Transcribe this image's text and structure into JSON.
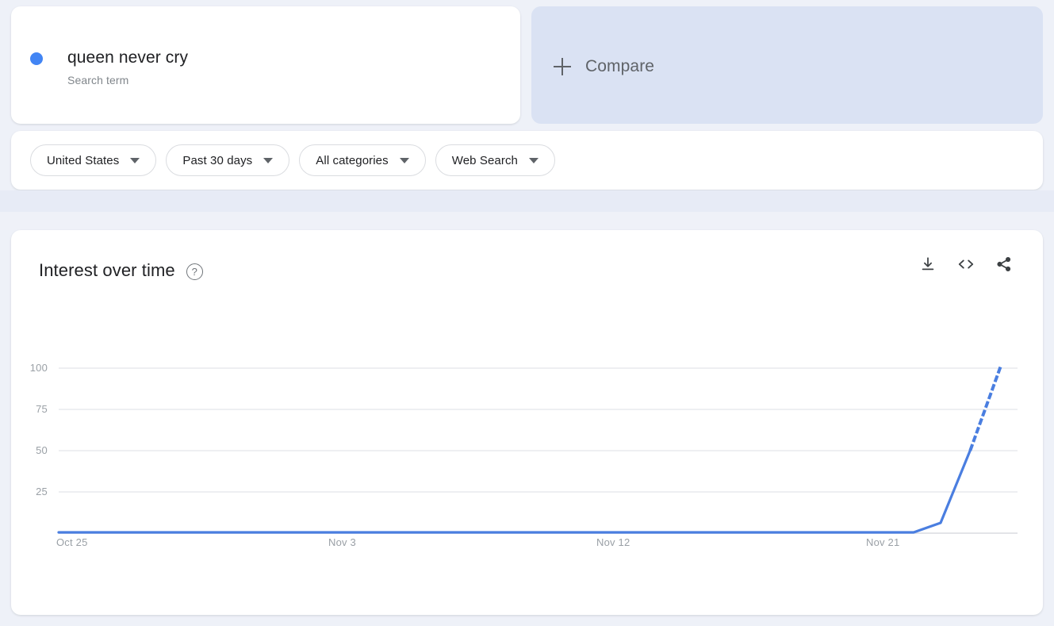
{
  "term_card": {
    "title": "queen never cry",
    "subtitle": "Search term",
    "dot_color": "#4285f4"
  },
  "compare_card": {
    "label": "Compare",
    "plus_icon": "plus-icon",
    "background": "#dae2f3"
  },
  "filters": [
    {
      "label": "United States"
    },
    {
      "label": "Past 30 days"
    },
    {
      "label": "All categories"
    },
    {
      "label": "Web Search"
    }
  ],
  "chart_card": {
    "title": "Interest over time",
    "help_icon": "help-circle-icon",
    "help_glyph": "?",
    "actions": [
      {
        "name": "download-icon"
      },
      {
        "name": "embed-code-icon"
      },
      {
        "name": "share-icon"
      }
    ]
  },
  "chart_data": {
    "type": "line",
    "title": "Interest over time",
    "xlabel": "",
    "ylabel": "",
    "ylim": [
      0,
      100
    ],
    "y_ticks": [
      100,
      75,
      50,
      25
    ],
    "x_ticks": [
      "Oct 25",
      "Nov 3",
      "Nov 12",
      "Nov 21"
    ],
    "grid": true,
    "legend": "none",
    "line_color": "#4a7ee0",
    "series": [
      {
        "name": "queen never cry",
        "partial_from_index": 29,
        "x": [
          "Oct 25",
          "Oct 26",
          "Oct 27",
          "Oct 28",
          "Oct 29",
          "Oct 30",
          "Oct 31",
          "Nov 1",
          "Nov 2",
          "Nov 3",
          "Nov 4",
          "Nov 5",
          "Nov 6",
          "Nov 7",
          "Nov 8",
          "Nov 9",
          "Nov 10",
          "Nov 11",
          "Nov 12",
          "Nov 13",
          "Nov 14",
          "Nov 15",
          "Nov 16",
          "Nov 17",
          "Nov 18",
          "Nov 19",
          "Nov 20",
          "Nov 21",
          "Nov 22",
          "Nov 23",
          "Nov 24"
        ],
        "values": [
          0,
          0,
          0,
          0,
          0,
          0,
          0,
          0,
          0,
          0,
          0,
          0,
          0,
          0,
          0,
          0,
          0,
          0,
          0,
          0,
          0,
          0,
          0,
          0,
          0,
          0,
          0,
          0,
          6,
          52,
          100
        ]
      }
    ]
  }
}
